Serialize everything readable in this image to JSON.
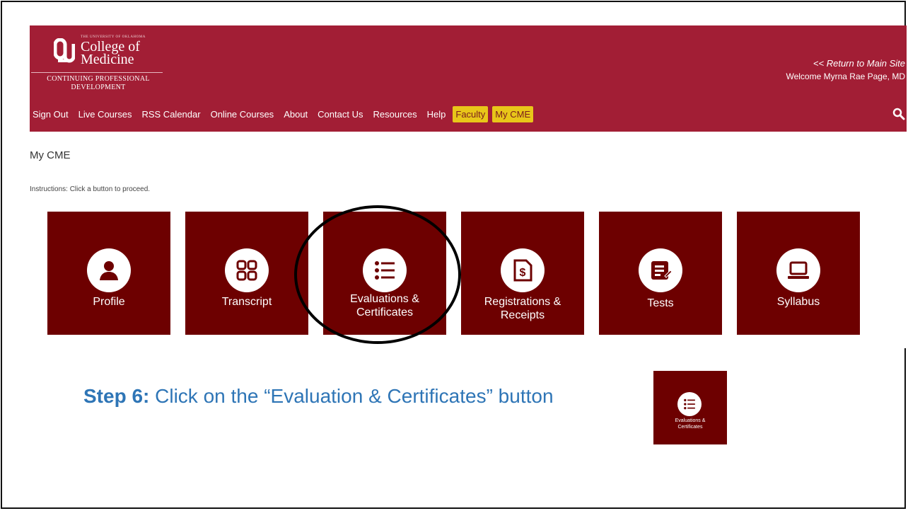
{
  "header": {
    "logo_small": "THE UNIVERSITY OF OKLAHOMA",
    "logo_college": "College of",
    "logo_medicine": "Medicine",
    "logo_cpd_line1": "CONTINUING PROFESSIONAL",
    "logo_cpd_line2": "DEVELOPMENT",
    "return_link": "<< Return to Main Site",
    "welcome": "Welcome Myrna Rae Page, MD"
  },
  "nav": {
    "items": [
      {
        "label": "Sign Out"
      },
      {
        "label": "Live Courses"
      },
      {
        "label": "RSS Calendar"
      },
      {
        "label": "Online Courses"
      },
      {
        "label": "About"
      },
      {
        "label": "Contact Us"
      },
      {
        "label": "Resources"
      },
      {
        "label": "Help"
      },
      {
        "label": "Faculty",
        "highlighted": true
      },
      {
        "label": "My CME",
        "highlighted": true
      }
    ],
    "search_icon": "search-icon"
  },
  "main": {
    "title": "My CME",
    "instructions": "Instructions: Click a button to proceed.",
    "tiles": [
      {
        "label_line1": "Profile",
        "label_line2": "",
        "icon": "user-icon"
      },
      {
        "label_line1": "Transcript",
        "label_line2": "",
        "icon": "grid-icon"
      },
      {
        "label_line1": "Evaluations &",
        "label_line2": "Certificates",
        "icon": "list-icon"
      },
      {
        "label_line1": "Registrations &",
        "label_line2": "Receipts",
        "icon": "receipt-icon"
      },
      {
        "label_line1": "Tests",
        "label_line2": "",
        "icon": "test-icon"
      },
      {
        "label_line1": "Syllabus",
        "label_line2": "",
        "icon": "laptop-icon"
      }
    ]
  },
  "step": {
    "label": "Step 6:",
    "text": " Click on the “Evaluation & Certificates” button"
  },
  "thumbnail": {
    "label_line1": "Evaluations &",
    "label_line2": "Certificates"
  },
  "colors": {
    "banner": "#a21e35",
    "tile": "#6d0000",
    "highlight": "#e8c619",
    "step_text": "#2e75b6"
  }
}
